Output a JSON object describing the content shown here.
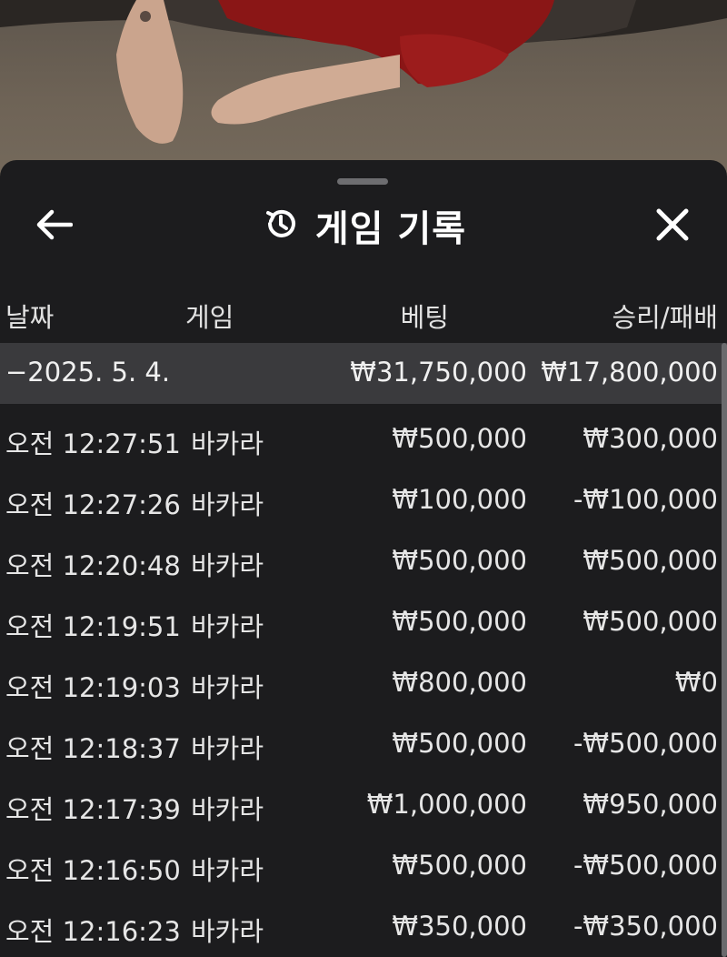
{
  "header": {
    "title": "게임 기록",
    "back_icon": "arrow-left-icon",
    "history_icon": "history-icon",
    "close_icon": "close-icon"
  },
  "columns": {
    "date": "날짜",
    "game": "게임",
    "bet": "베팅",
    "result": "승리/패배"
  },
  "summary": {
    "date": "−2025. 5. 4.",
    "bet": "₩31,750,000",
    "result": "₩17,800,000"
  },
  "rows": [
    {
      "time": "오전 12:27:51",
      "game": "바카라",
      "bet": "₩500,000",
      "result": "₩300,000"
    },
    {
      "time": "오전 12:27:26",
      "game": "바카라",
      "bet": "₩100,000",
      "result": "-₩100,000"
    },
    {
      "time": "오전 12:20:48",
      "game": "바카라",
      "bet": "₩500,000",
      "result": "₩500,000"
    },
    {
      "time": "오전 12:19:51",
      "game": "바카라",
      "bet": "₩500,000",
      "result": "₩500,000"
    },
    {
      "time": "오전 12:19:03",
      "game": "바카라",
      "bet": "₩800,000",
      "result": "₩0"
    },
    {
      "time": "오전 12:18:37",
      "game": "바카라",
      "bet": "₩500,000",
      "result": "-₩500,000"
    },
    {
      "time": "오전 12:17:39",
      "game": "바카라",
      "bet": "₩1,000,000",
      "result": "₩950,000"
    },
    {
      "time": "오전 12:16:50",
      "game": "바카라",
      "bet": "₩500,000",
      "result": "-₩500,000"
    },
    {
      "time": "오전 12:16:23",
      "game": "바카라",
      "bet": "₩350,000",
      "result": "-₩350,000"
    }
  ],
  "colors": {
    "sheet_bg": "#1c1c1e",
    "summary_bg": "#3a3a3d",
    "text": "#e6e6e6"
  }
}
